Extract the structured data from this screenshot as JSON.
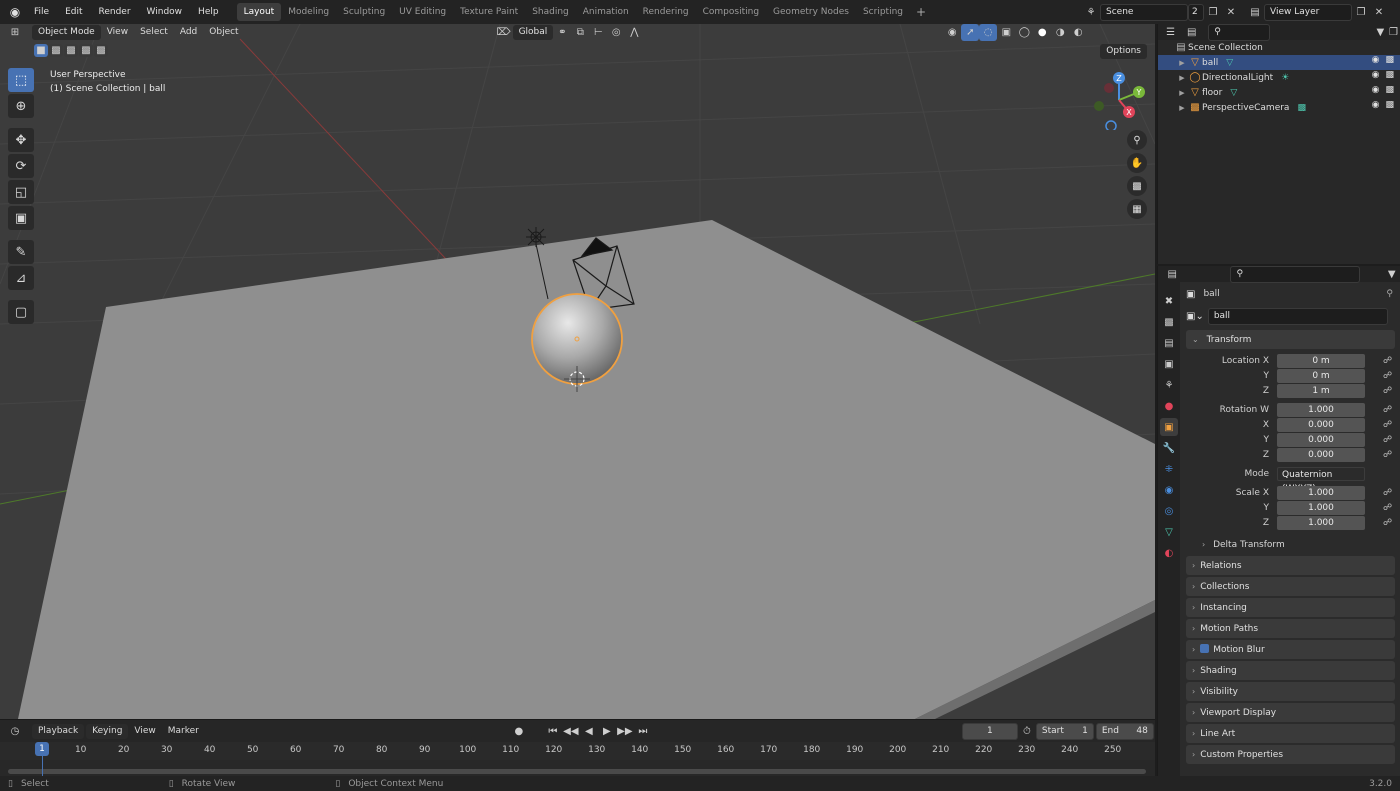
{
  "topbar": {
    "menus": [
      "File",
      "Edit",
      "Render",
      "Window",
      "Help"
    ],
    "workspaces": [
      "Layout",
      "Modeling",
      "Sculpting",
      "UV Editing",
      "Texture Paint",
      "Shading",
      "Animation",
      "Rendering",
      "Compositing",
      "Geometry Nodes",
      "Scripting"
    ],
    "active_workspace": "Layout",
    "scene_name": "Scene",
    "scene_users": "2",
    "view_layer": "View Layer"
  },
  "viewport": {
    "mode": "Object Mode",
    "menus": [
      "View",
      "Select",
      "Add",
      "Object"
    ],
    "orientation": "Global",
    "options": "Options",
    "info_line1": "User Perspective",
    "info_line2": "(1) Scene Collection | ball",
    "gizmo": {
      "z": "Z",
      "y": "Y",
      "x": "X"
    }
  },
  "timeline": {
    "menus": [
      "Playback",
      "Keying",
      "View",
      "Marker"
    ],
    "current_frame": "1",
    "start_label": "Start",
    "start": "1",
    "end_label": "End",
    "end": "48",
    "ticks": [
      "1",
      "10",
      "20",
      "30",
      "40",
      "50",
      "60",
      "70",
      "80",
      "90",
      "100",
      "110",
      "120",
      "130",
      "140",
      "150",
      "160",
      "170",
      "180",
      "190",
      "200",
      "210",
      "220",
      "230",
      "240",
      "250"
    ]
  },
  "statusbar": {
    "select": "Select",
    "rotate": "Rotate View",
    "context": "Object Context Menu",
    "version": "3.2.0"
  },
  "outliner": {
    "root": "Scene Collection",
    "items": [
      {
        "name": "ball",
        "selected": true,
        "icon_color": "#f0a040"
      },
      {
        "name": "DirectionalLight",
        "selected": false,
        "icon_color": "#f0a040"
      },
      {
        "name": "floor",
        "selected": false,
        "icon_color": "#f0a040"
      },
      {
        "name": "PerspectiveCamera",
        "selected": false,
        "icon_color": "#f0a040"
      }
    ]
  },
  "properties": {
    "object_name": "ball",
    "data_name": "ball",
    "transform": {
      "title": "Transform",
      "location_label": "Location X",
      "location": [
        "0 m",
        "0 m",
        "1 m"
      ],
      "rotation_label": "Rotation W",
      "rotation": [
        "1.000",
        "0.000",
        "0.000",
        "0.000"
      ],
      "mode_label": "Mode",
      "mode": "Quaternion (WXYZ)",
      "scale_label": "Scale X",
      "scale": [
        "1.000",
        "1.000",
        "1.000"
      ],
      "y_label": "Y",
      "z_label": "Z",
      "x_label": "X",
      "delta": "Delta Transform"
    },
    "panels": [
      "Relations",
      "Collections",
      "Instancing",
      "Motion Paths",
      "Motion Blur",
      "Shading",
      "Visibility",
      "Viewport Display",
      "Line Art",
      "Custom Properties"
    ]
  },
  "colors": {
    "accent": "#4772b3",
    "selection_outline": "#f0a040",
    "floor": "#8f8f8f",
    "viewport_bg": "#3c3c3c"
  }
}
